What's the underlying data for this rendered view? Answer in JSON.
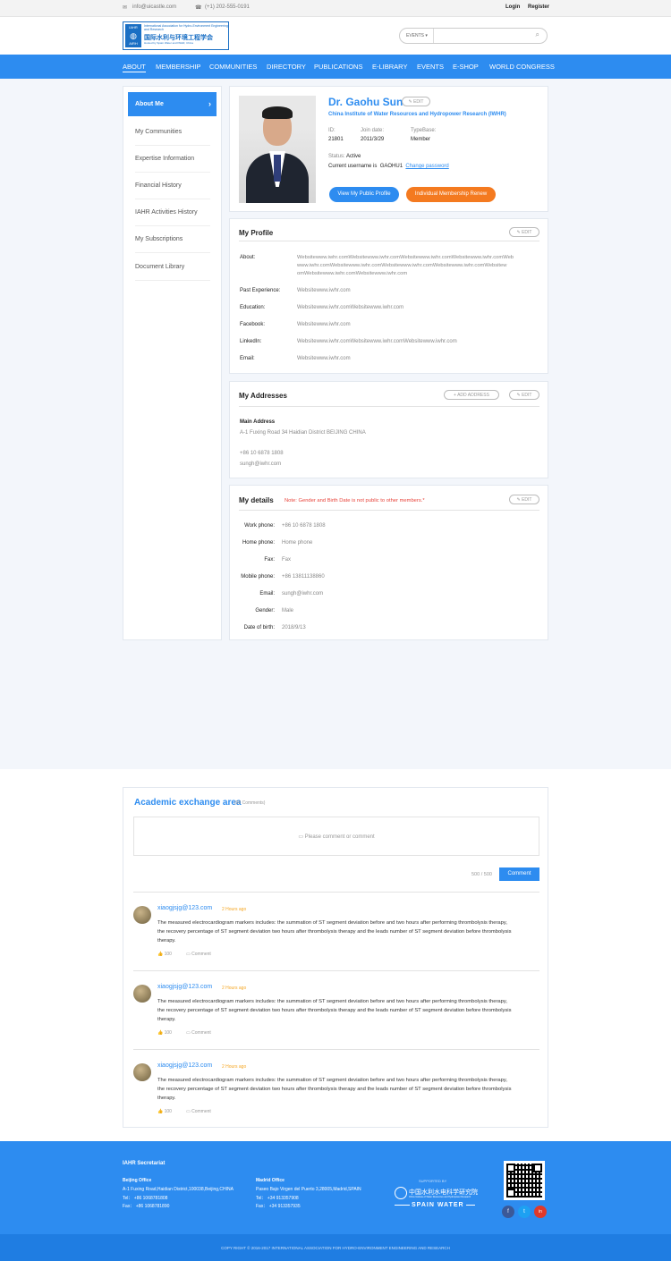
{
  "topbar": {
    "email": "info@uicastle.com",
    "phone": "(+1) 202-555-0191",
    "login": "Login",
    "register": "Register"
  },
  "logo": {
    "mark_top": "IAHR",
    "mark_bottom": "AIRH",
    "en": "International Association for Hydro-Environment Engineering and Research",
    "cn": "国际水利与环境工程学会",
    "sub": "Hosted by Spain Water and IWHR, China"
  },
  "search": {
    "category": "EVENTS",
    "placeholder": ""
  },
  "nav": {
    "items": [
      "ABOUT",
      "MEMBERSHIP",
      "COMMUNITIES",
      "DIRECTORY",
      "PUBLICATIONS",
      "E-LIBRARY",
      "EVENTS",
      "E-SHOP",
      "WORLD CONGRESS"
    ]
  },
  "sidebar": {
    "items": [
      "About Me",
      "My Communities",
      "Expertise Information",
      "Financial History",
      "IAHR Activities History",
      "My Subscriptions",
      "Document Library"
    ]
  },
  "profile": {
    "name": "Dr. Gaohu Sun",
    "edit": "EDIT",
    "org": "China Institute of Water Resources and Hydropower Research (IWHR)",
    "id_label": "ID:",
    "id": "21801",
    "join_label": "Join date:",
    "join": "2011/3/29",
    "type_label": "TypeBase:",
    "type": "Member",
    "status_label": "Status:",
    "status": "Active",
    "username_label": "Current username is",
    "username": "GAOHU1",
    "change_pw": "Change password",
    "btn_public": "View My Public Profile",
    "btn_renew": "Individual Membership Renew"
  },
  "my_profile": {
    "title": "My Profile",
    "edit": "EDIT",
    "about_label": "About:",
    "about": [
      "Websitewww.iwhr.comWebsitewww.iwhr.comWebsitewww.iwhr.comWebsitewww.iwhr.comWeb",
      "www.iwhr.comWebsitewww.iwhr.comWebsitewww.iwhr.comWebsitewww.iwhr.comWebsitew",
      "omWebsitewww.iwhr.comWebsitewww.iwhr.com"
    ],
    "rows": [
      {
        "label": "Past Experience:",
        "value": "Websitewww.iwhr.com"
      },
      {
        "label": "Education:",
        "value": "Websitewww.iwhr.comWebsitewww.iwhr.com"
      },
      {
        "label": "Facebook:",
        "value": "Websitewww.iwhr.com"
      },
      {
        "label": "LinkedIn:",
        "value": "Websitewww.iwhr.comWebsitewww.iwhr.comWebsitewww.iwhr.com"
      },
      {
        "label": "Email:",
        "value": "Websitewww.iwhr.com"
      }
    ]
  },
  "addresses": {
    "title": "My Addresses",
    "add": "ADD ADDRESS",
    "edit": "EDIT",
    "main_label": "Main Address",
    "address": "A-1 Fuxing Road 34 Haidian District BEIJING CHINA",
    "phone": "+86 10 6878 1808",
    "email": "sungh@iwhr.com"
  },
  "details": {
    "title": "My details",
    "note": "Note: Gender and Birth Date is not public to other members.*",
    "edit": "EDIT",
    "rows": [
      {
        "label": "Work phone:",
        "value": "+86 10 6878 1808"
      },
      {
        "label": "Home phone:",
        "value": "Home phone"
      },
      {
        "label": "Fax:",
        "value": "Fax"
      },
      {
        "label": "Mobile phone:",
        "value": "+86 13811138860"
      },
      {
        "label": "Email:",
        "value": "sungh@iwhr.com"
      },
      {
        "label": "Gender:",
        "value": "Male"
      },
      {
        "label": "Date of birth:",
        "value": "2018/9/13"
      }
    ]
  },
  "exchange": {
    "title": "Academic exchange area",
    "count": "(98 Comments)",
    "placeholder": "Please comment or comment",
    "counter": "500 / 500",
    "submit": "Comment",
    "comments": [
      {
        "user": "xiaogjsjg@123.com",
        "time": "2 Hours ago",
        "text": [
          "The measured electrocardiogram markers includes: the summation of ST segment deviation before and two hours after performing thrombolysis therapy,",
          "the recovery percentage of ST segment deviation two hours after thrombolysis therapy and the leads number of ST segment deviation before thrombolysis",
          "therapy."
        ],
        "likes": "100",
        "reply": "Comment"
      },
      {
        "user": "xiaogjsjg@123.com",
        "time": "2 Hours ago",
        "text": [
          "The measured electrocardiogram markers includes: the summation of ST segment deviation before and two hours after performing thrombolysis therapy,",
          "the recovery percentage of ST segment deviation two hours after thrombolysis therapy and the leads number of ST segment deviation before thrombolysis",
          "therapy."
        ],
        "likes": "100",
        "reply": "Comment"
      },
      {
        "user": "xiaogjsjg@123.com",
        "time": "2 Hours ago",
        "text": [
          "The measured electrocardiogram markers includes: the summation of ST segment deviation before and two hours after performing thrombolysis therapy,",
          "the recovery percentage of ST segment deviation two hours after thrombolysis therapy and the leads number of ST segment deviation before thrombolysis",
          "therapy."
        ],
        "likes": "100",
        "reply": "Comment"
      }
    ]
  },
  "footer": {
    "title": "IAHR Secretariat",
    "beijing": {
      "name": "Beijing Office",
      "addr": "A-1 Fuxing Road,Haidian District,100038,Beijing,CHINA",
      "tel": "Tel：  +86 1068781808",
      "fax": "Fax：  +86 1068781890"
    },
    "madrid": {
      "name": "Madrid Office",
      "addr": "Paseo Bajo Virgen del Puerto 3,28005,Madrid,SPAIN",
      "tel": "Tel：  +34 913357908",
      "fax": "Fax：  +34 913357935"
    },
    "supported": "SUPPORTED BY",
    "iwhr_cn": "中国水利水电科学研究院",
    "iwhr_en": "China Institute of Water Resources and Hydropower Research",
    "spain": "SPAIN WATER",
    "social": [
      "f",
      "t",
      "in"
    ],
    "copyright": "COPY RIGHT © 2016-2017 INTERNATIONAL ASSOCIATION FOR HYDRO-ENVIRONMENT ENGINEERING AND RESEARCH"
  },
  "colors": {
    "primary": "#2d8cf0",
    "orange": "#f47a20",
    "note": "#e8453c",
    "link": "#2d8cf0",
    "time": "#f5a623"
  }
}
